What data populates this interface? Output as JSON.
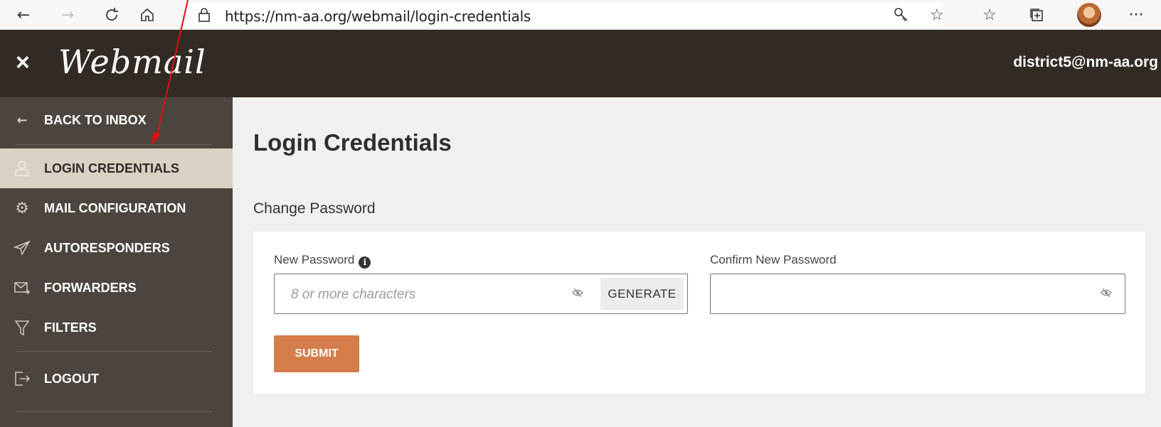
{
  "browser": {
    "url": "https://nm-aa.org/webmail/login-credentials"
  },
  "header": {
    "close_symbol": "×",
    "logo": "Webmail",
    "account": "district5@nm-aa.org"
  },
  "sidebar": {
    "back": "BACK TO INBOX",
    "items": [
      {
        "label": "LOGIN CREDENTIALS",
        "icon": "user-icon",
        "active": true
      },
      {
        "label": "MAIL CONFIGURATION",
        "icon": "gear-icon"
      },
      {
        "label": "AUTORESPONDERS",
        "icon": "paper-plane-icon"
      },
      {
        "label": "FORWARDERS",
        "icon": "mail-forward-icon"
      },
      {
        "label": "FILTERS",
        "icon": "filter-icon"
      }
    ],
    "logout": "LOGOUT"
  },
  "main": {
    "title": "Login Credentials",
    "section": "Change Password",
    "new_password_label": "New Password",
    "new_password_placeholder": "8 or more characters",
    "generate": "GENERATE",
    "confirm_label": "Confirm New Password",
    "submit": "SUBMIT"
  },
  "colors": {
    "header_bg": "#322b25",
    "sidebar_bg": "#4c453f",
    "active_item_bg": "#d8d2c6",
    "submit_bg": "#d57d4b",
    "annotation_arrow": "#e01010"
  }
}
